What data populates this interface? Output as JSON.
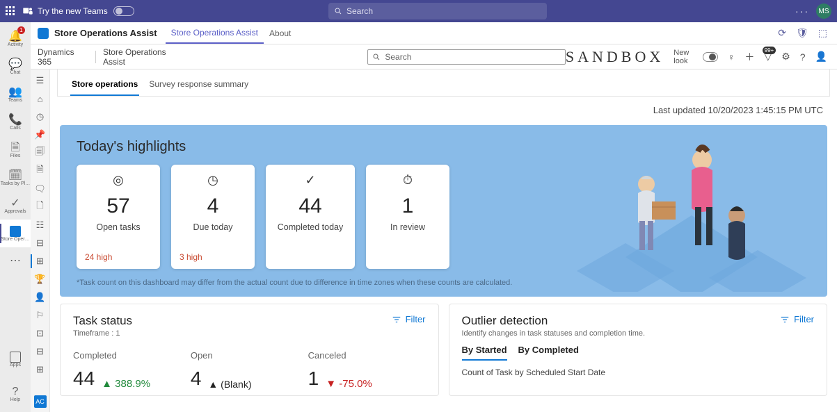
{
  "teams_top": {
    "try_label": "Try the new Teams",
    "search_placeholder": "Search",
    "avatar_initials": "MS"
  },
  "rail": {
    "items": [
      {
        "label": "Activity",
        "icon": "🔔",
        "badge": "1"
      },
      {
        "label": "Chat",
        "icon": "💬"
      },
      {
        "label": "Teams",
        "icon": "👥"
      },
      {
        "label": "Calls",
        "icon": "📞"
      },
      {
        "label": "Files",
        "icon": "📄"
      },
      {
        "label": "Tasks by Pl…",
        "icon": "🗓"
      },
      {
        "label": "Approvals",
        "icon": "✔"
      },
      {
        "label": "Store Oper…",
        "icon": "box",
        "selected": true
      },
      {
        "label": "",
        "icon": "⋯"
      }
    ],
    "apps_label": "Apps",
    "help_label": "Help"
  },
  "app_header": {
    "title": "Store Operations Assist",
    "tabs": [
      {
        "label": "Store Operations Assist",
        "active": true
      },
      {
        "label": "About"
      }
    ]
  },
  "cmdbar": {
    "breadcrumb_root": "Dynamics 365",
    "breadcrumb_app": "Store Operations Assist",
    "search_placeholder": "Search",
    "sandbox_label": "SANDBOX",
    "new_look_label": "New look",
    "alert_count": "99+"
  },
  "page": {
    "tabs": [
      {
        "label": "Store operations",
        "active": true
      },
      {
        "label": "Survey response summary"
      }
    ],
    "last_updated": "Last updated 10/20/2023 1:45:15 PM UTC"
  },
  "highlights": {
    "title": "Today's highlights",
    "tiles": [
      {
        "icon": "target",
        "value": "57",
        "label": "Open tasks",
        "high": "24 high"
      },
      {
        "icon": "clock",
        "value": "4",
        "label": "Due today",
        "high": "3 high"
      },
      {
        "icon": "check",
        "value": "44",
        "label": "Completed today"
      },
      {
        "icon": "timer",
        "value": "1",
        "label": "In review"
      }
    ],
    "disclaimer": "*Task count on this dashboard may differ from the actual count due to difference in time zones when these counts are calculated."
  },
  "task_status": {
    "title": "Task status",
    "timeframe_label": "Timeframe : 1",
    "filter_label": "Filter",
    "cols": [
      {
        "head": "Completed",
        "value": "44",
        "delta": "388.9%",
        "dir": "up-green"
      },
      {
        "head": "Open",
        "value": "4",
        "delta": "(Blank)",
        "dir": "up-black"
      },
      {
        "head": "Canceled",
        "value": "1",
        "delta": "-75.0%",
        "dir": "down-red"
      }
    ]
  },
  "outlier": {
    "title": "Outlier detection",
    "subtitle": "Identify changes in task statuses and completion time.",
    "filter_label": "Filter",
    "tabs": [
      {
        "label": "By Started",
        "active": true
      },
      {
        "label": "By Completed"
      }
    ],
    "chart_title": "Count of Task by Scheduled Start Date"
  }
}
